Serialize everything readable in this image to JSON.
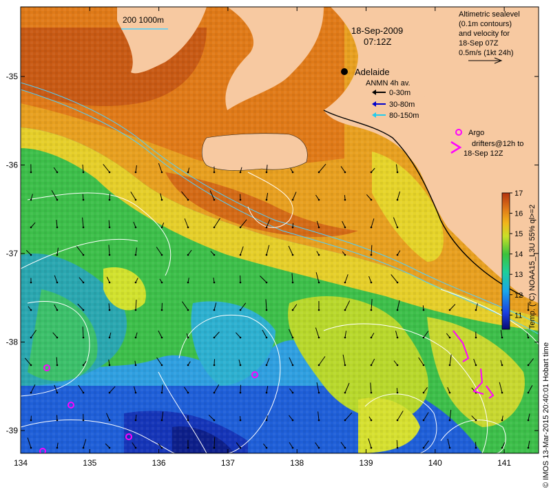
{
  "map": {
    "date": "18-Sep-2009",
    "time": "07:12Z",
    "city": "Adelaide",
    "scale_legend": "200  1000m",
    "sealevel_note": [
      "Altimetric sealevel",
      "(0.1m contours)",
      "and velocity for",
      "18-Sep 07Z",
      "0.5m/s (1kt 24h)"
    ],
    "anmn": {
      "title": "ANMN 4h av.",
      "items": [
        {
          "label": "0-30m",
          "color": "#000000"
        },
        {
          "label": "30-80m",
          "color": "#0000cc"
        },
        {
          "label": "80-150m",
          "color": "#22ccee"
        }
      ]
    },
    "argo_label": "Argo",
    "drifters_label": [
      "drifters@12h to",
      "18-Sep 12Z"
    ],
    "colorbar": {
      "label": "Temp. (°C) NOAA15_L3U 55% ql>=2",
      "ticks": [
        "17",
        "16",
        "15",
        "14",
        "13",
        "12",
        "11"
      ],
      "min": 10.3,
      "max": 17
    },
    "credit": "© IMOS 13-Mar-2015 20:40:01 Hobart time",
    "x_ticks": [
      "134",
      "135",
      "136",
      "137",
      "138",
      "139",
      "140",
      "141"
    ],
    "y_ticks": [
      "-35",
      "-36",
      "-37",
      "-38",
      "-39"
    ],
    "colors": {
      "land": "#f5c9a1",
      "sst_warm": "#e07a18",
      "sst_cool": "#1a3fd0",
      "argo": "#ff00ff"
    }
  }
}
